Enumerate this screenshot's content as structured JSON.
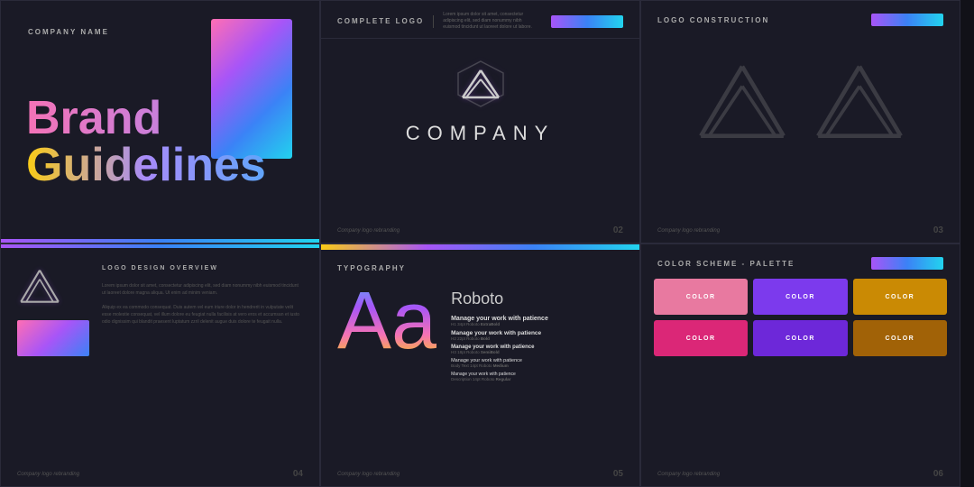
{
  "cards": {
    "card1": {
      "company_label": "COMPANY NAME",
      "brand_line1": "Brand",
      "brand_line2": "Guidelines"
    },
    "card2": {
      "title": "COMPLETE LOGO",
      "description": "Lorem ipsum dolor sit amet, consectetur adipiscing elit, sed diam nonummy nibh euismod tincidunt ut laoreet dolore ut labore.",
      "company_name": "COMPANY",
      "footer_text": "Company logo rebranding",
      "page_num": "02"
    },
    "card3": {
      "title": "LOGO CONSTRUCTION",
      "footer_text": "Company logo rebranding",
      "page_num": "03"
    },
    "card4": {
      "title": "LOGO DESIGN\nOVERVIEW",
      "body_text1": "Lorem ipsum dolor sit amet, consectetur adipiscing elit, sed diam nonummy nibh euismod tincidunt ut laoreet dolore magna aliqua. Ut enim ad minim veniam.",
      "body_text2": "Aliquip ex ea commodo consequat. Duis autem vel eum iriure dolor in hendrerit in vulputate velit esse molestie consequat, vel illum dolore eu feugiat nulla facilisis at vero eros et accumsan et iusto odio dignissim qui blandit praesent luptatum zzril delenit augue duis dolore te feugait nulla.",
      "footer_text": "Company logo rebranding",
      "page_num": "04"
    },
    "card5": {
      "title": "TYPOGRAPHY",
      "font_name": "Roboto",
      "aa_text": "Aa",
      "samples": [
        {
          "text": "Manage your work with patience",
          "meta": "H1  34pt  Roboto ExtraBold"
        },
        {
          "text": "Manage your work with patience",
          "meta": "H2  22pt  Roboto Bold"
        },
        {
          "text": "Manage your work with patience",
          "meta": "H3  18pt  Roboto SemiBold"
        },
        {
          "text": "Manage your work with patience",
          "meta": "Body Text  14pt  Roboto Medium"
        },
        {
          "text": "Manage your work with patience",
          "meta": "Description  14pt  Roboto Regular"
        }
      ],
      "footer_text": "Company logo rebranding",
      "page_num": "05"
    },
    "card6": {
      "title": "COLOR SCHEME - PALETTE",
      "swatches": [
        "COLOR",
        "COLOR",
        "COLOR",
        "COLOR",
        "COLOR",
        "COLOR"
      ],
      "footer_text": "Company logo rebranding",
      "page_num": "06"
    }
  }
}
